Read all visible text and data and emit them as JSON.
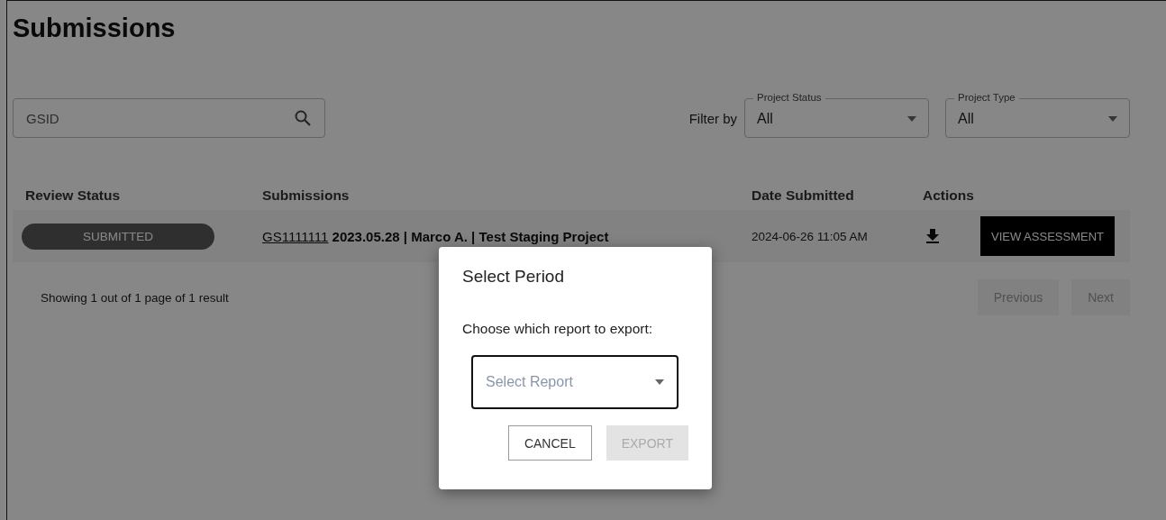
{
  "title": "Submissions",
  "search": {
    "placeholder": "GSID"
  },
  "filter_label": "Filter by",
  "filters": [
    {
      "label": "Project Status",
      "value": "All"
    },
    {
      "label": "Project Type",
      "value": "All"
    }
  ],
  "table": {
    "columns": [
      "Review Status",
      "Submissions",
      "Date Submitted",
      "Actions"
    ],
    "rows": [
      {
        "status": "SUBMITTED",
        "gsid": "GS1111111",
        "description": "2023.05.28 | Marco A. | Test Staging Project",
        "date": "2024-06-26 11:05 AM",
        "action": "VIEW ASSESSMENT"
      }
    ]
  },
  "pagination": {
    "summary": "Showing 1 out of 1 page of 1 result",
    "buttons": [
      {
        "label": "Previous",
        "disabled": true
      },
      {
        "label": "Next",
        "disabled": true
      }
    ]
  },
  "dialog": {
    "title": "Select Period",
    "prompt": "Choose which report to export:",
    "select": {
      "placeholder": "Select Report"
    },
    "buttons": [
      {
        "label": "CANCEL",
        "disabled": false
      },
      {
        "label": "EXPORT",
        "disabled": true
      }
    ]
  }
}
